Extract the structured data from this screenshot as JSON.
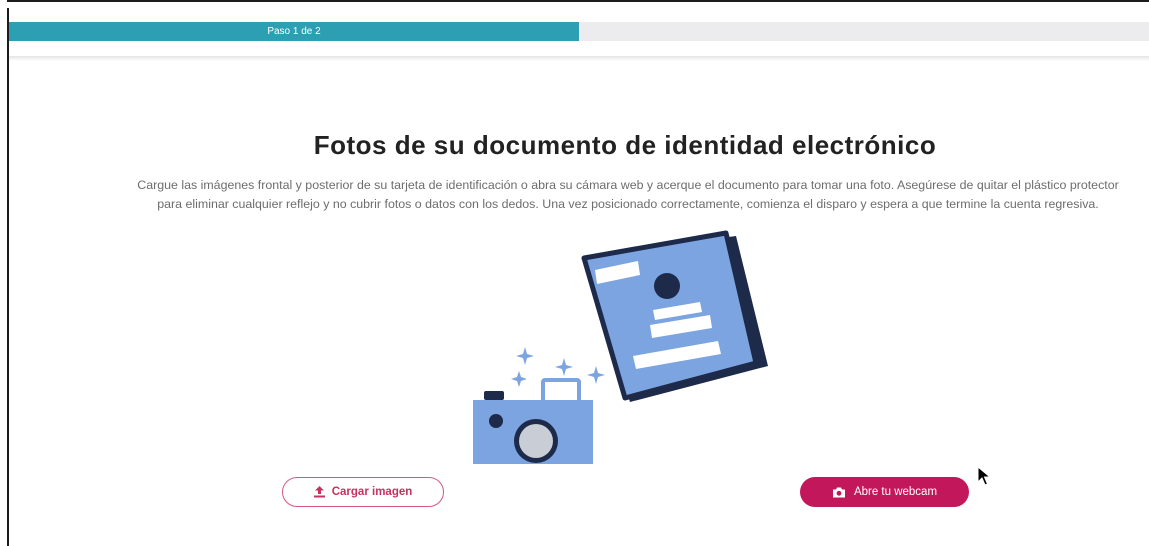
{
  "progress": {
    "label": "Paso 1 de 2",
    "fraction": 0.5,
    "fill_color": "#2d9fb3",
    "track_color": "#ececef"
  },
  "main": {
    "title": "Fotos de su documento de identidad electrónico",
    "instructions": "Cargue las imágenes frontal y posterior de su tarjeta de identificación o abra su cámara web y acerque el documento para tomar una foto. Asegúrese de quitar el plástico protector para eliminar cualquier reflejo y no cubrir fotos o datos con los dedos. Una vez posicionado correctamente, comienza el disparo y espera a que termine la cuenta regresiva."
  },
  "illustration": {
    "icons": [
      "id-document-icon",
      "camera-icon",
      "sparkle-icon"
    ]
  },
  "actions": {
    "upload_label": "Cargar imagen",
    "upload_icon": "upload-icon",
    "webcam_label": "Abre tu webcam",
    "webcam_icon": "camera-icon"
  },
  "colors": {
    "accent": "#c2185b",
    "illustration_blue": "#7ba4e0",
    "illustration_dark": "#1e2a4a"
  }
}
